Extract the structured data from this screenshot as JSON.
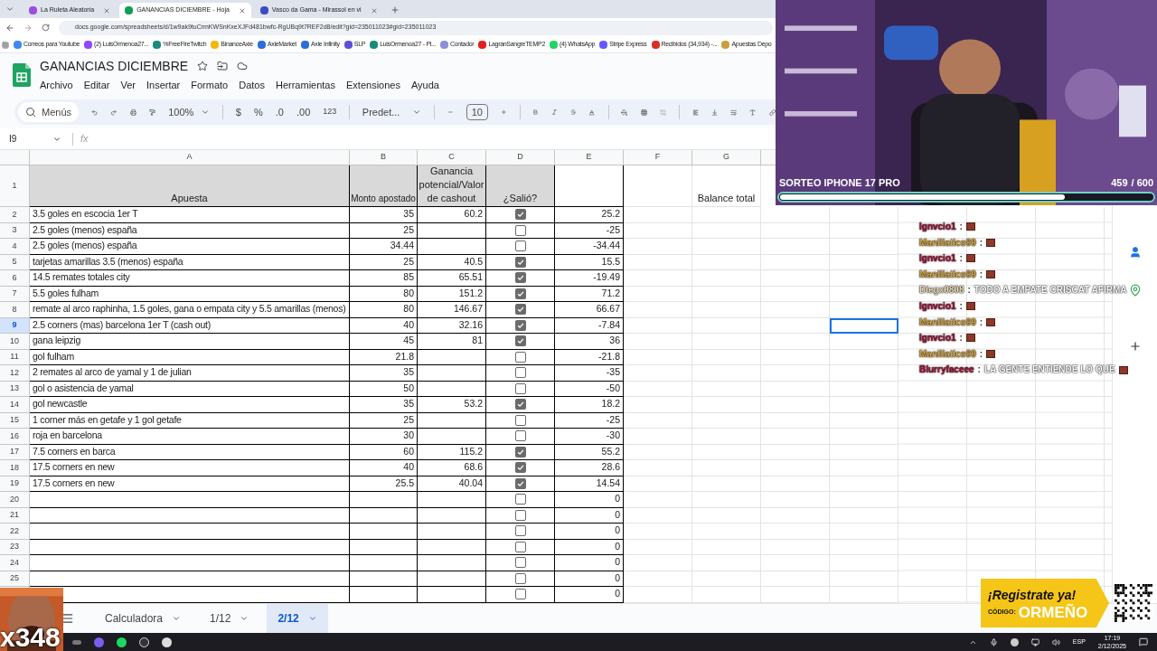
{
  "browser": {
    "tabs": [
      {
        "title": "La Ruleta Aleatoria",
        "selected": false,
        "color": "#9b4de0"
      },
      {
        "title": "GANANCIAS DICIEMBRE - Hoja",
        "selected": true,
        "color": "#0f9d58"
      },
      {
        "title": "Vasco da Gama - Mirassol en vi",
        "selected": false,
        "color": "#3b4bc8"
      }
    ],
    "url": "docs.google.com/spreadsheets/d/1w9ak9tuCrmKWSnKxeXJFd481bwfc-RgUBq9t7REF2d8/edit?gid=235011023#gid=235011023",
    "bookmarks": [
      {
        "label": "Correos para Youtube",
        "color": "#4285f4"
      },
      {
        "label": "(2) LuisOrmenoa27...",
        "color": "#9146ff"
      },
      {
        "label": "%FreeFireTwitch",
        "color": "#1a8a7a"
      },
      {
        "label": "BinanceAxie",
        "color": "#f0b90b"
      },
      {
        "label": "AxieMarket",
        "color": "#2a6fdb"
      },
      {
        "label": "Axie Infinity",
        "color": "#2a6fdb"
      },
      {
        "label": "SLP",
        "color": "#5b4fd8"
      },
      {
        "label": "LuisOrmenoa27 - Pl...",
        "color": "#1a8a7a"
      },
      {
        "label": "Contador",
        "color": "#8f8fd8"
      },
      {
        "label": "LagranSangreTEMP2",
        "color": "#e02020"
      },
      {
        "label": "(4) WhatsApp",
        "color": "#25d366"
      },
      {
        "label": "Stripe Express",
        "color": "#635bff"
      },
      {
        "label": "Recibidos (34,934) -...",
        "color": "#d93025"
      },
      {
        "label": "Apuestas Depo",
        "color": "#c8a040"
      }
    ]
  },
  "doc": {
    "title": "GANANCIAS DICIEMBRE",
    "menus": [
      "Archivo",
      "Editar",
      "Ver",
      "Insertar",
      "Formato",
      "Datos",
      "Herramientas",
      "Extensiones",
      "Ayuda"
    ]
  },
  "toolbar": {
    "search": "Menús",
    "zoom": "100%",
    "currency": "$",
    "percent": "%",
    "decimals_less": ".0",
    "decimals_more": ".00",
    "number_format": "123",
    "font": "Predet...",
    "font_size": "10"
  },
  "formula_bar": {
    "cell": "I9",
    "fx": "fx"
  },
  "columns": [
    "A",
    "B",
    "C",
    "D",
    "E",
    "F",
    "G"
  ],
  "header": {
    "row_number": "1",
    "apuesta": "Apuesta",
    "monto": "Monto apostado",
    "ganancia": "Ganancia potencial/Valor de cashout",
    "salio": "¿Salió?",
    "balance": "Balance total"
  },
  "rows": [
    {
      "number": "2",
      "apuesta": "3.5 goles en escocia 1er T",
      "monto": "35",
      "ganancia": "60.2",
      "salio": true,
      "resultado": "25.2",
      "selected": false
    },
    {
      "number": "3",
      "apuesta": "2.5 goles (menos) españa",
      "monto": "25",
      "ganancia": "",
      "salio": false,
      "resultado": "-25",
      "selected": false
    },
    {
      "number": "4",
      "apuesta": "2.5 goles (menos) españa",
      "monto": "34.44",
      "ganancia": "",
      "salio": false,
      "resultado": "-34.44",
      "selected": false
    },
    {
      "number": "5",
      "apuesta": "tarjetas amarillas 3.5 (menos) españa",
      "monto": "25",
      "ganancia": "40.5",
      "salio": true,
      "resultado": "15.5",
      "selected": false
    },
    {
      "number": "6",
      "apuesta": "14.5 remates totales city",
      "monto": "85",
      "ganancia": "65.51",
      "salio": true,
      "resultado": "-19.49",
      "selected": false
    },
    {
      "number": "7",
      "apuesta": "5.5 goles fulham",
      "monto": "80",
      "ganancia": "151.2",
      "salio": true,
      "resultado": "71.2",
      "selected": false
    },
    {
      "number": "8",
      "apuesta": "remate al arco raphinha, 1.5 goles, gana o empata city y 5.5 amarillas (menos)",
      "monto": "80",
      "ganancia": "146.67",
      "salio": true,
      "resultado": "66.67",
      "selected": false
    },
    {
      "number": "9",
      "apuesta": "2.5 corners (mas) barcelona 1er T (cash out)",
      "monto": "40",
      "ganancia": "32.16",
      "salio": true,
      "resultado": "-7.84",
      "selected": true
    },
    {
      "number": "10",
      "apuesta": "gana leipzig",
      "monto": "45",
      "ganancia": "81",
      "salio": true,
      "resultado": "36",
      "selected": false
    },
    {
      "number": "11",
      "apuesta": "gol fulham",
      "monto": "21.8",
      "ganancia": "",
      "salio": false,
      "resultado": "-21.8",
      "selected": false
    },
    {
      "number": "12",
      "apuesta": "2 remates al arco de yamal y 1 de julian",
      "monto": "35",
      "ganancia": "",
      "salio": false,
      "resultado": "-35",
      "selected": false
    },
    {
      "number": "13",
      "apuesta": "gol o asistencia de yamal",
      "monto": "50",
      "ganancia": "",
      "salio": false,
      "resultado": "-50",
      "selected": false
    },
    {
      "number": "14",
      "apuesta": "gol newcastle",
      "monto": "35",
      "ganancia": "53.2",
      "salio": true,
      "resultado": "18.2",
      "selected": false
    },
    {
      "number": "15",
      "apuesta": "1 corner más en getafe y 1 gol getafe",
      "monto": "25",
      "ganancia": "",
      "salio": false,
      "resultado": "-25",
      "selected": false
    },
    {
      "number": "16",
      "apuesta": "roja en barcelona",
      "monto": "30",
      "ganancia": "",
      "salio": false,
      "resultado": "-30",
      "selected": false
    },
    {
      "number": "17",
      "apuesta": "7.5 corners en barca",
      "monto": "60",
      "ganancia": "115.2",
      "salio": true,
      "resultado": "55.2",
      "selected": false
    },
    {
      "number": "18",
      "apuesta": "17.5 corners en new",
      "monto": "40",
      "ganancia": "68.6",
      "salio": true,
      "resultado": "28.6",
      "selected": false
    },
    {
      "number": "19",
      "apuesta": "17.5 corners en new",
      "monto": "25.5",
      "ganancia": "40.04",
      "salio": true,
      "resultado": "14.54",
      "selected": false
    },
    {
      "number": "20",
      "apuesta": "",
      "monto": "",
      "ganancia": "",
      "salio": false,
      "resultado": "0",
      "selected": false
    },
    {
      "number": "21",
      "apuesta": "",
      "monto": "",
      "ganancia": "",
      "salio": false,
      "resultado": "0",
      "selected": false
    },
    {
      "number": "22",
      "apuesta": "",
      "monto": "",
      "ganancia": "",
      "salio": false,
      "resultado": "0",
      "selected": false
    },
    {
      "number": "23",
      "apuesta": "",
      "monto": "",
      "ganancia": "",
      "salio": false,
      "resultado": "0",
      "selected": false
    },
    {
      "number": "24",
      "apuesta": "",
      "monto": "",
      "ganancia": "",
      "salio": false,
      "resultado": "0",
      "selected": false
    },
    {
      "number": "25",
      "apuesta": "",
      "monto": "",
      "ganancia": "",
      "salio": false,
      "resultado": "0",
      "selected": false
    },
    {
      "apuesta": "",
      "monto": "",
      "ganancia": "",
      "salio": false,
      "resultado": "0",
      "selected": false
    }
  ],
  "sheet_tabs": [
    {
      "label": "Calculadora",
      "selected": false
    },
    {
      "label": "1/12",
      "selected": false
    },
    {
      "label": "2/12",
      "selected": true
    }
  ],
  "stream": {
    "goal": {
      "title": "SORTEO IPHONE 17 PRO",
      "current": "459",
      "total": "/ 600",
      "level": 0.765
    },
    "chat": [
      {
        "user": "Ignvcio1",
        "color": "#a3133a",
        "sep": ":",
        "emote": true
      },
      {
        "user": "Maniliatico99",
        "color": "#d4a33a",
        "sep": ":",
        "emote": true
      },
      {
        "user": "Ignvcio1",
        "color": "#a3133a",
        "sep": ":",
        "emote": true
      },
      {
        "user": "Maniliatico99",
        "color": "#d4a33a",
        "sep": ":",
        "emote": true
      },
      {
        "user": "Diegx0808",
        "color": "#e9dcb6",
        "sep": ":",
        "text": "TODO A EMPATE CRISCAT AFIRMA",
        "emote": false
      },
      {
        "user": "Ignvcio1",
        "color": "#a3133a",
        "sep": ":",
        "emote": true
      },
      {
        "user": "Maniliatico99",
        "color": "#d4a33a",
        "sep": ":",
        "emote": true
      },
      {
        "user": "Ignvcio1",
        "color": "#a3133a",
        "sep": ":",
        "emote": true
      },
      {
        "user": "Maniliatico99",
        "color": "#d4a33a",
        "sep": ":",
        "emote": true
      },
      {
        "user": "Blurryfaceee",
        "color": "#a3133a",
        "sep": ":",
        "text": "LA GENTE ENTIENDE LO QUE",
        "emote": true
      }
    ],
    "combo": "x348",
    "ad": {
      "headline": "¡Registrate ya!",
      "code_label": "CÓDIGO:",
      "code": "ORMEÑO"
    }
  },
  "taskbar": {
    "language": "ESP",
    "time": "17:19",
    "date": "2/12/2025"
  }
}
